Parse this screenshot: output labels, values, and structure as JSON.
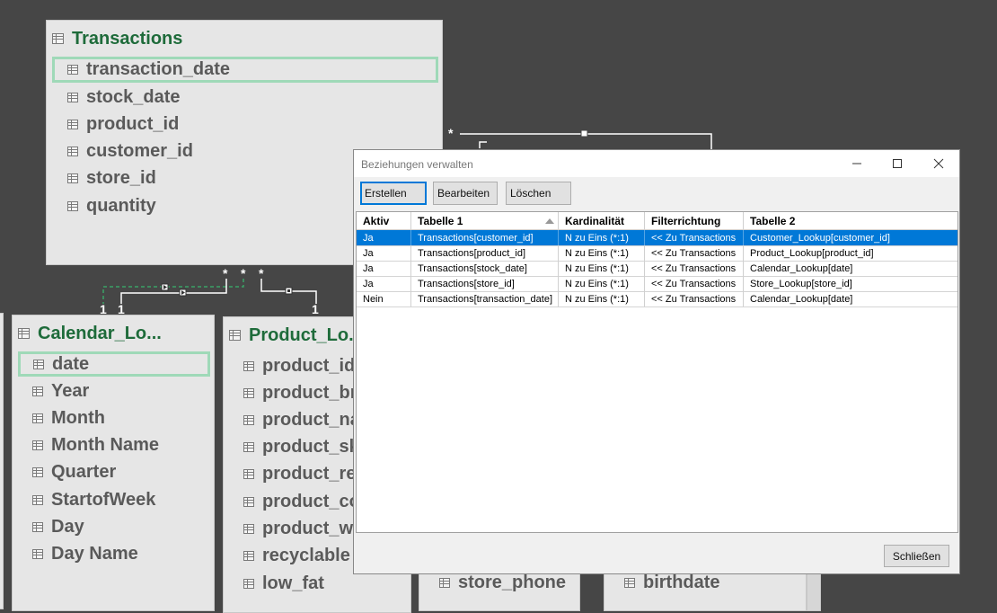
{
  "diagram": {
    "transactions": {
      "title": "Transactions",
      "fields": [
        "transaction_date",
        "stock_date",
        "product_id",
        "customer_id",
        "store_id",
        "quantity"
      ]
    },
    "calendar": {
      "title": "Calendar_Lo...",
      "fields": [
        "date",
        "Year",
        "Month",
        "Month Name",
        "Quarter",
        "StartofWeek",
        "Day",
        "Day Name"
      ]
    },
    "product": {
      "title": "Product_Lo...",
      "fields": [
        "product_id",
        "product_brand",
        "product_name",
        "product_sku",
        "product_retail_price",
        "product_cost",
        "product_weight",
        "recyclable",
        "low_fat"
      ]
    },
    "store": {
      "visible_field": "store_phone"
    },
    "customer": {
      "visible_field": "birthdate"
    },
    "labels": {
      "many": "*",
      "one": "1"
    }
  },
  "dialog": {
    "title": "Beziehungen verwalten",
    "buttons": {
      "create": "Erstellen",
      "edit": "Bearbeiten",
      "delete": "Löschen",
      "close": "Schließen"
    },
    "columns": [
      "Aktiv",
      "Tabelle 1",
      "Kardinalität",
      "Filterrichtung",
      "Tabelle 2"
    ],
    "rows": [
      [
        "Ja",
        "Transactions[customer_id]",
        "N zu Eins (*:1)",
        "<< Zu Transactions",
        "Customer_Lookup[customer_id]"
      ],
      [
        "Ja",
        "Transactions[product_id]",
        "N zu Eins (*:1)",
        "<< Zu Transactions",
        "Product_Lookup[product_id]"
      ],
      [
        "Ja",
        "Transactions[stock_date]",
        "N zu Eins (*:1)",
        "<< Zu Transactions",
        "Calendar_Lookup[date]"
      ],
      [
        "Ja",
        "Transactions[store_id]",
        "N zu Eins (*:1)",
        "<< Zu Transactions",
        "Store_Lookup[store_id]"
      ],
      [
        "Nein",
        "Transactions[transaction_date]",
        "N zu Eins (*:1)",
        "<< Zu Transactions",
        "Calendar_Lookup[date]"
      ]
    ],
    "selected_row": 0
  },
  "colors": {
    "background": "#464646",
    "card": "#e6e6e6",
    "title": "#1e6b3a",
    "field_text": "#5a5a5a",
    "highlight": "#9fd9b8",
    "selection": "#0078d7"
  }
}
